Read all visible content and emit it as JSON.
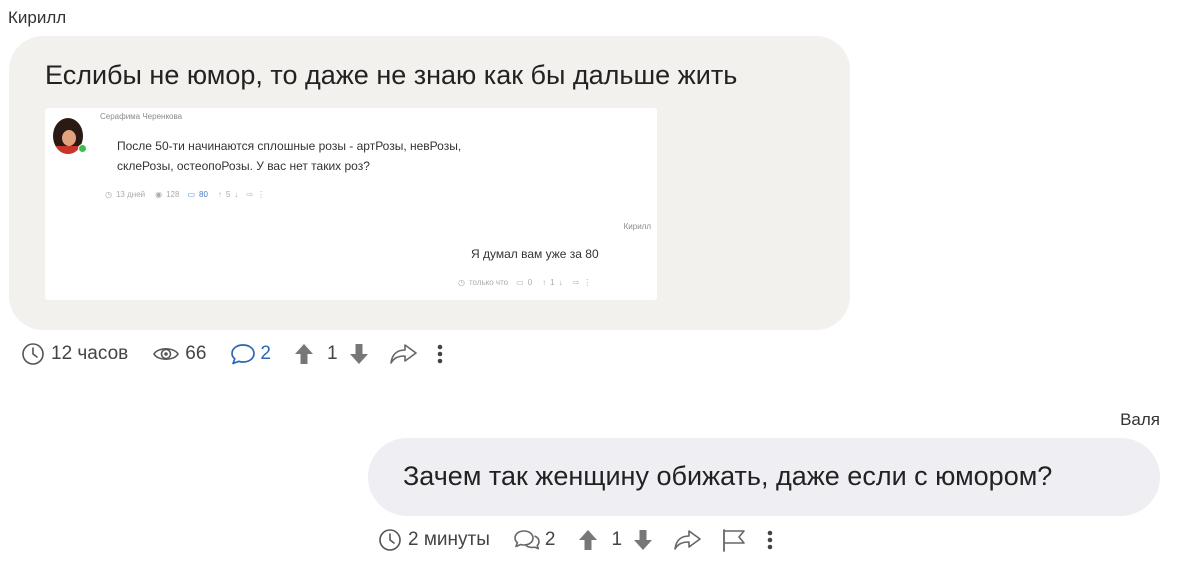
{
  "comment1": {
    "author": "Кирилл",
    "text": "Еслибы не юмор, то даже не знаю как бы дальше жить",
    "screenshot": {
      "name": "Серафима Черенкова",
      "text_line1": "После 50-ти начинаются сплошные розы - артРозы, невРозы,",
      "text_line2": "склеРозы, остеопоРозы. У вас нет таких роз?",
      "time": "13 дней",
      "views": "128",
      "comments": "80",
      "rating": "5",
      "reply_author": "Кирилл",
      "reply_text": "Я думал вам уже за 80",
      "reply_time": "только что",
      "reply_comments": "0",
      "reply_rating": "1"
    },
    "time": "12 часов",
    "views": "66",
    "comments": "2",
    "rating": "1"
  },
  "comment2": {
    "author": "Валя",
    "text": "Зачем так женщину обижать, даже если с юмором?",
    "time": "2 минуты",
    "comments": "2",
    "rating": "1"
  },
  "colors": {
    "link_blue": "#2a67b3",
    "bubble_left": "#f2f1ee",
    "bubble_right": "#efeef3"
  }
}
